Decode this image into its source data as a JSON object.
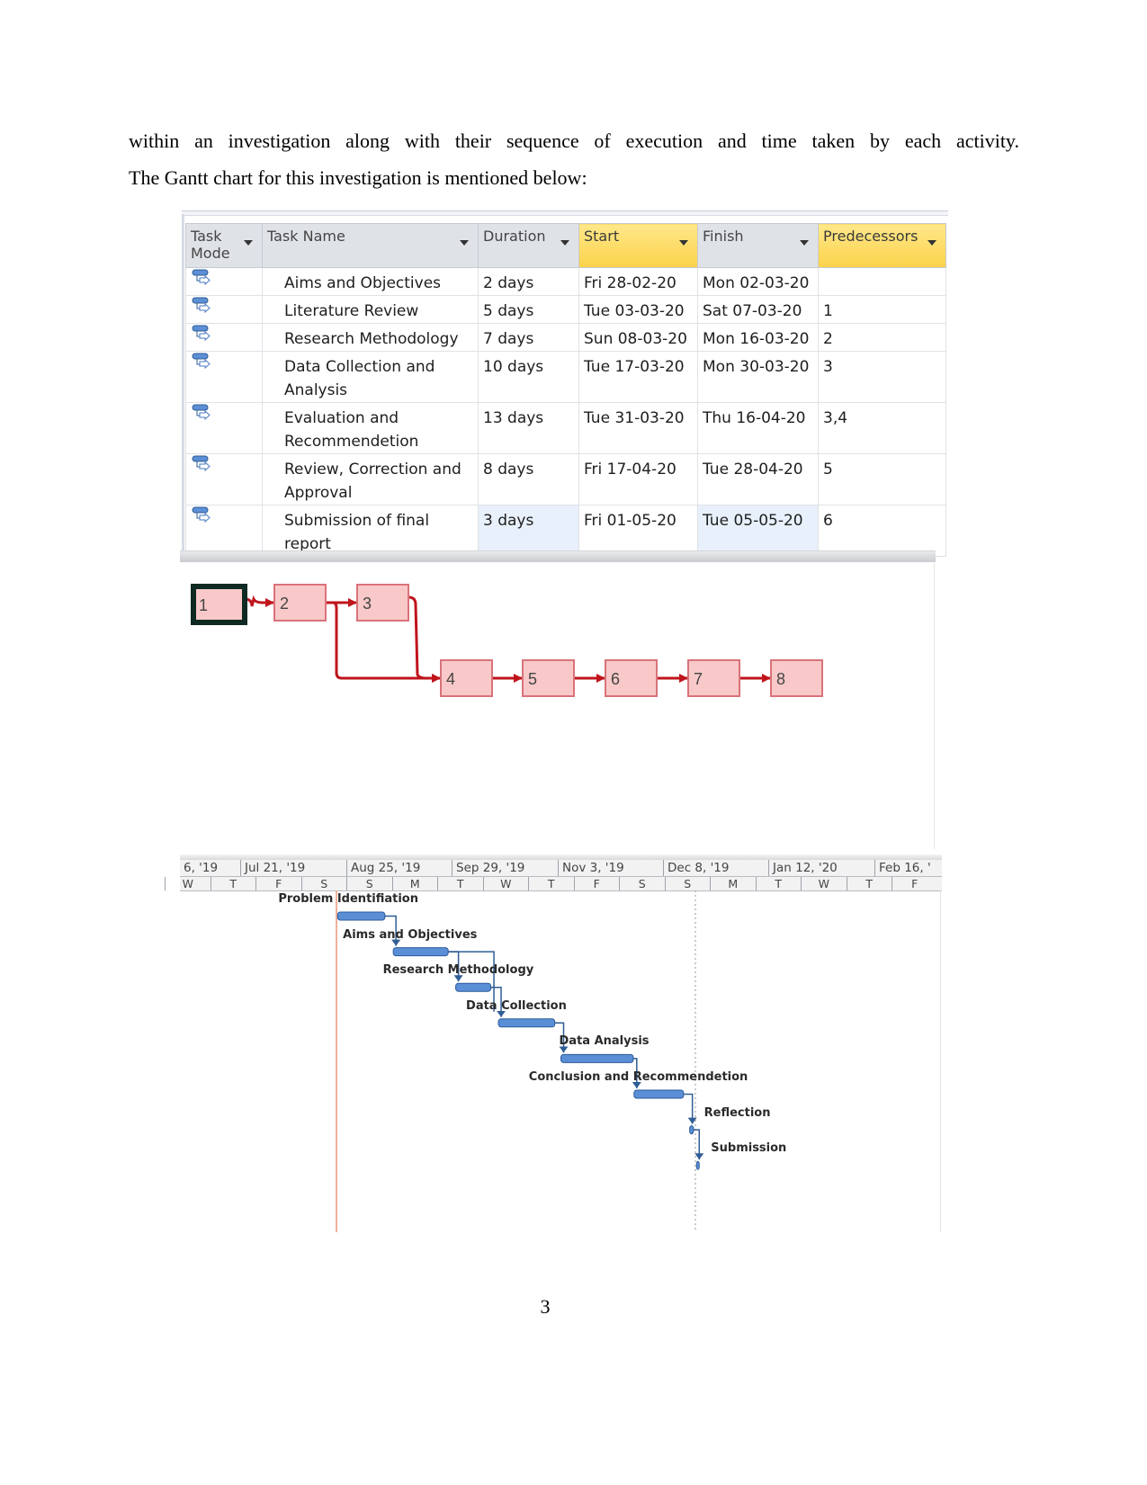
{
  "document": {
    "paragraph_line1": "within an investigation along with their sequence of execution and time taken by each activity.",
    "paragraph_line2": "The Gantt chart for this investigation is mentioned below:",
    "page_number": "3"
  },
  "task_table": {
    "columns": [
      "Task Mode",
      "Task Name",
      "Duration",
      "Start",
      "Finish",
      "Predecessors"
    ],
    "column_mode_line1": "Task",
    "column_mode_line2": "Mode",
    "highlighted_columns": [
      "Start",
      "Predecessors"
    ],
    "mode_icon": "auto-scheduled-task-icon",
    "rows": [
      {
        "name_line1": "Aims and Objectives",
        "name_line2": "",
        "duration": "2 days",
        "start": "Fri 28-02-20",
        "finish": "Mon 02-03-20",
        "predecessors": ""
      },
      {
        "name_line1": "Literature Review",
        "name_line2": "",
        "duration": "5 days",
        "start": "Tue 03-03-20",
        "finish": "Sat 07-03-20",
        "predecessors": "1"
      },
      {
        "name_line1": "Research Methodology",
        "name_line2": "",
        "duration": "7 days",
        "start": "Sun 08-03-20",
        "finish": "Mon 16-03-20",
        "predecessors": "2"
      },
      {
        "name_line1": "Data Collection and",
        "name_line2": "Analysis",
        "duration": "10 days",
        "start": "Tue 17-03-20",
        "finish": "Mon 30-03-20",
        "predecessors": "3"
      },
      {
        "name_line1": "Evaluation and",
        "name_line2": "Recommendetion",
        "duration": "13 days",
        "start": "Tue 31-03-20",
        "finish": "Thu 16-04-20",
        "predecessors": "3,4"
      },
      {
        "name_line1": "Review, Correction and",
        "name_line2": "Approval",
        "duration": "8 days",
        "start": "Fri 17-04-20",
        "finish": "Tue 28-04-20",
        "predecessors": "5"
      },
      {
        "name_line1": "Submission of final",
        "name_line2": "report",
        "duration": "3 days",
        "start": "Fri 01-05-20",
        "finish": "Tue 05-05-20",
        "predecessors": "6"
      }
    ]
  },
  "network_diagram": {
    "nodes": [
      "1",
      "2",
      "3",
      "4",
      "5",
      "6",
      "7",
      "8"
    ],
    "links": [
      [
        "1",
        "2"
      ],
      [
        "2",
        "3"
      ],
      [
        "2",
        "4"
      ],
      [
        "3",
        "4"
      ],
      [
        "4",
        "5"
      ],
      [
        "5",
        "6"
      ],
      [
        "6",
        "7"
      ],
      [
        "7",
        "8"
      ]
    ],
    "colors": {
      "node_fill": "#f9c9c9",
      "node_border": "#d9737a",
      "link": "#c0141d",
      "selected_border": "#0f2a22"
    }
  },
  "gantt": {
    "major_scale": [
      "6, '19",
      "Jul 21, '19",
      "Aug 25, '19",
      "Sep 29, '19",
      "Nov 3, '19",
      "Dec 8, '19",
      "Jan 12, '20",
      "Feb 16, '"
    ],
    "minor_scale": [
      "W",
      "T",
      "F",
      "S",
      "S",
      "M",
      "T",
      "W",
      "T",
      "F",
      "S",
      "S",
      "M",
      "T",
      "W",
      "T",
      "F"
    ],
    "tasks": [
      {
        "label": "Problem Identifiation",
        "bar_start_frac": 0.207,
        "bar_end_frac": 0.269
      },
      {
        "label": "Aims and Objectives",
        "bar_start_frac": 0.28,
        "bar_end_frac": 0.352
      },
      {
        "label": "Research Methodology",
        "bar_start_frac": 0.362,
        "bar_end_frac": 0.408
      },
      {
        "label": "Data Collection",
        "bar_start_frac": 0.418,
        "bar_end_frac": 0.492
      },
      {
        "label": "Data Analysis",
        "bar_start_frac": 0.5,
        "bar_end_frac": 0.595
      },
      {
        "label": "Conclusion and Recommendetion",
        "bar_start_frac": 0.596,
        "bar_end_frac": 0.661
      },
      {
        "label": "Reflection",
        "bar_start_frac": 0.669,
        "bar_end_frac": 0.674
      },
      {
        "label": "Submission",
        "bar_start_frac": 0.678,
        "bar_end_frac": 0.681
      }
    ],
    "colors": {
      "bar": "#5a8fd6",
      "bar_border": "#2c5a9a",
      "link": "#2f5d95",
      "today_line": "#f0b09a",
      "status_line": "#b8b8b8"
    }
  }
}
